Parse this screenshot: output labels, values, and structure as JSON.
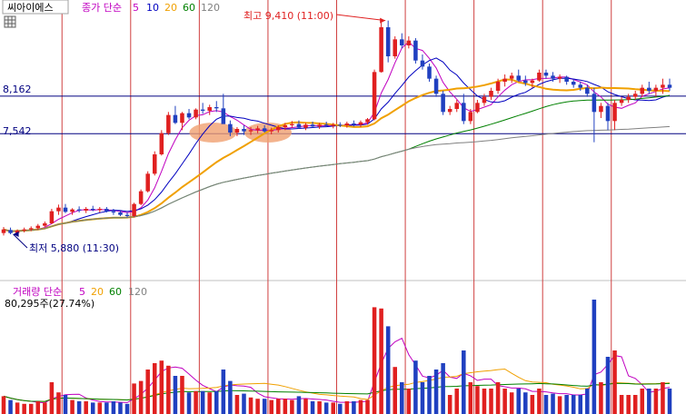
{
  "header": {
    "stock_name": "씨아이에스",
    "price_title": "종가 단순",
    "ma_periods": [
      "5",
      "10",
      "20",
      "60",
      "120"
    ],
    "ma_colors": [
      "#c000c0",
      "#0000c0",
      "#f0a000",
      "#008000",
      "#808080"
    ],
    "volume_title": "거래량 단순",
    "volume_ma_periods": [
      "5",
      "20",
      "60",
      "120"
    ],
    "volume_readout": "80,295주(27.74%)"
  },
  "price_axis": {
    "upper_line_label": "8,162",
    "lower_line_label": "7,542",
    "upper_line_value": 8162,
    "lower_line_value": 7542,
    "range": [
      5250,
      9660
    ]
  },
  "annotations": {
    "high": "최고 9,410 (11:00)",
    "low": "최저 5,880 (11:30)",
    "high_value": 9410,
    "low_value": 5880
  },
  "colors": {
    "up": "#e02020",
    "down": "#2040c0",
    "session_line": "#d04040",
    "ref_line": "#000080",
    "highlight": "#f0a070"
  },
  "chart_data": {
    "type": "candlestick",
    "n_bars": 98,
    "session_starts": [
      9,
      19,
      29,
      39,
      49,
      59,
      69,
      79,
      89
    ],
    "candles": [
      [
        5900,
        6000,
        5860,
        5960
      ],
      [
        5950,
        5990,
        5880,
        5900
      ],
      [
        5900,
        5960,
        5870,
        5940
      ],
      [
        5940,
        5990,
        5910,
        5960
      ],
      [
        5960,
        6010,
        5930,
        5980
      ],
      [
        5980,
        6050,
        5950,
        6020
      ],
      [
        6020,
        6090,
        6000,
        6060
      ],
      [
        6060,
        6300,
        6050,
        6260
      ],
      [
        6260,
        6370,
        6200,
        6320
      ],
      [
        6320,
        6380,
        6230,
        6250
      ],
      [
        6250,
        6310,
        6200,
        6290
      ],
      [
        6290,
        6340,
        6240,
        6270
      ],
      [
        6270,
        6330,
        6230,
        6300
      ],
      [
        6300,
        6350,
        6260,
        6280
      ],
      [
        6280,
        6330,
        6240,
        6300
      ],
      [
        6300,
        6330,
        6240,
        6260
      ],
      [
        6260,
        6300,
        6200,
        6240
      ],
      [
        6240,
        6270,
        6180,
        6200
      ],
      [
        6200,
        6240,
        6160,
        6180
      ],
      [
        6180,
        6400,
        6160,
        6380
      ],
      [
        6380,
        6620,
        6360,
        6590
      ],
      [
        6590,
        6920,
        6570,
        6880
      ],
      [
        6880,
        7250,
        6850,
        7200
      ],
      [
        7200,
        7600,
        7180,
        7550
      ],
      [
        7550,
        7900,
        7520,
        7850
      ],
      [
        7850,
        8000,
        7700,
        7720
      ],
      [
        7720,
        7900,
        7600,
        7880
      ],
      [
        7880,
        7950,
        7780,
        7810
      ],
      [
        7810,
        7960,
        7780,
        7940
      ],
      [
        7940,
        8050,
        7870,
        7920
      ],
      [
        7920,
        8020,
        7850,
        7980
      ],
      [
        7980,
        8080,
        7900,
        7960
      ],
      [
        7960,
        8200,
        7850,
        7700
      ],
      [
        7700,
        7760,
        7500,
        7560
      ],
      [
        7560,
        7650,
        7500,
        7620
      ],
      [
        7620,
        7680,
        7520,
        7580
      ],
      [
        7580,
        7650,
        7520,
        7600
      ],
      [
        7600,
        7670,
        7550,
        7630
      ],
      [
        7630,
        7680,
        7560,
        7580
      ],
      [
        7580,
        7640,
        7530,
        7600
      ],
      [
        7600,
        7680,
        7560,
        7650
      ],
      [
        7650,
        7720,
        7600,
        7680
      ],
      [
        7680,
        7750,
        7640,
        7700
      ],
      [
        7700,
        7760,
        7620,
        7640
      ],
      [
        7640,
        7720,
        7600,
        7690
      ],
      [
        7690,
        7740,
        7640,
        7660
      ],
      [
        7660,
        7720,
        7620,
        7690
      ],
      [
        7690,
        7740,
        7650,
        7670
      ],
      [
        7670,
        7720,
        7630,
        7690
      ],
      [
        7690,
        7730,
        7650,
        7680
      ],
      [
        7680,
        7740,
        7640,
        7710
      ],
      [
        7710,
        7760,
        7660,
        7690
      ],
      [
        7690,
        7760,
        7650,
        7730
      ],
      [
        7730,
        7800,
        7690,
        7780
      ],
      [
        7780,
        8600,
        7760,
        8560
      ],
      [
        8560,
        9380,
        8550,
        9300
      ],
      [
        9300,
        9410,
        8720,
        8820
      ],
      [
        8820,
        9150,
        8780,
        9100
      ],
      [
        9100,
        9200,
        8950,
        9000
      ],
      [
        9000,
        9150,
        8950,
        9080
      ],
      [
        9080,
        9120,
        8700,
        8750
      ],
      [
        8750,
        8850,
        8600,
        8650
      ],
      [
        8650,
        8700,
        8400,
        8450
      ],
      [
        8450,
        8500,
        8150,
        8200
      ],
      [
        8200,
        8250,
        7850,
        7900
      ],
      [
        7900,
        8000,
        7850,
        7950
      ],
      [
        7950,
        8100,
        7900,
        8050
      ],
      [
        8050,
        8200,
        7700,
        7750
      ],
      [
        7750,
        7950,
        7700,
        7900
      ],
      [
        7900,
        8100,
        7880,
        8050
      ],
      [
        8050,
        8200,
        8000,
        8150
      ],
      [
        8150,
        8300,
        8100,
        8250
      ],
      [
        8250,
        8450,
        8200,
        8400
      ],
      [
        8400,
        8520,
        8320,
        8450
      ],
      [
        8450,
        8550,
        8380,
        8500
      ],
      [
        8500,
        8600,
        8400,
        8420
      ],
      [
        8420,
        8500,
        8330,
        8380
      ],
      [
        8380,
        8450,
        8300,
        8420
      ],
      [
        8420,
        8600,
        8400,
        8550
      ],
      [
        8550,
        8600,
        8450,
        8500
      ],
      [
        8500,
        8560,
        8400,
        8450
      ],
      [
        8450,
        8520,
        8380,
        8480
      ],
      [
        8480,
        8500,
        8350,
        8400
      ],
      [
        8400,
        8450,
        8300,
        8350
      ],
      [
        8350,
        8400,
        8250,
        8300
      ],
      [
        8300,
        8350,
        8150,
        8200
      ],
      [
        8200,
        8300,
        7400,
        7900
      ],
      [
        7900,
        8050,
        7800,
        8000
      ],
      [
        8000,
        8050,
        7600,
        7750
      ],
      [
        7750,
        8100,
        7600,
        8050
      ],
      [
        8050,
        8150,
        8000,
        8100
      ],
      [
        8100,
        8200,
        8050,
        8150
      ],
      [
        8150,
        8250,
        8100,
        8200
      ],
      [
        8200,
        8350,
        8150,
        8300
      ],
      [
        8300,
        8400,
        8200,
        8250
      ],
      [
        8250,
        8350,
        8150,
        8300
      ],
      [
        8300,
        8450,
        8200,
        8350
      ],
      [
        8350,
        8450,
        8250,
        8300
      ]
    ]
  }
}
